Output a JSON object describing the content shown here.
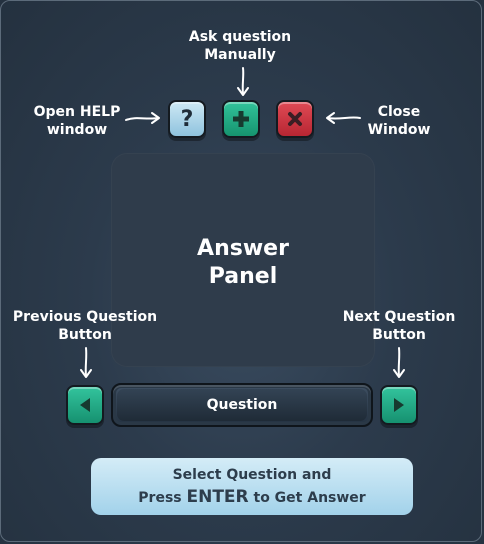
{
  "labels": {
    "ask_line1": "Ask question",
    "ask_line2": "Manually",
    "help_line1": "Open HELP",
    "help_line2": "window",
    "close_line1": "Close",
    "close_line2": "Window",
    "prev_line1": "Previous Question",
    "prev_line2": "Button",
    "next_line1": "Next Question",
    "next_line2": "Button"
  },
  "buttons": {
    "help_glyph": "?",
    "add_icon": "plus-icon",
    "close_icon": "close-icon",
    "prev_icon": "triangle-left-icon",
    "next_icon": "triangle-right-icon"
  },
  "panel": {
    "line1": "Answer",
    "line2": "Panel"
  },
  "question_bar": {
    "text": "Question"
  },
  "info": {
    "line1": "Select Question and",
    "line2_pre": "Press ",
    "line2_key": "ENTER",
    "line2_post": " to Get Answer"
  },
  "colors": {
    "background": "#2c3b4c",
    "help_button": "#8fc3de",
    "add_button": "#16946f",
    "close_button": "#b72633",
    "nav_button": "#169170",
    "info_box": "#a2d2ea",
    "info_text": "#2d3d4c"
  }
}
